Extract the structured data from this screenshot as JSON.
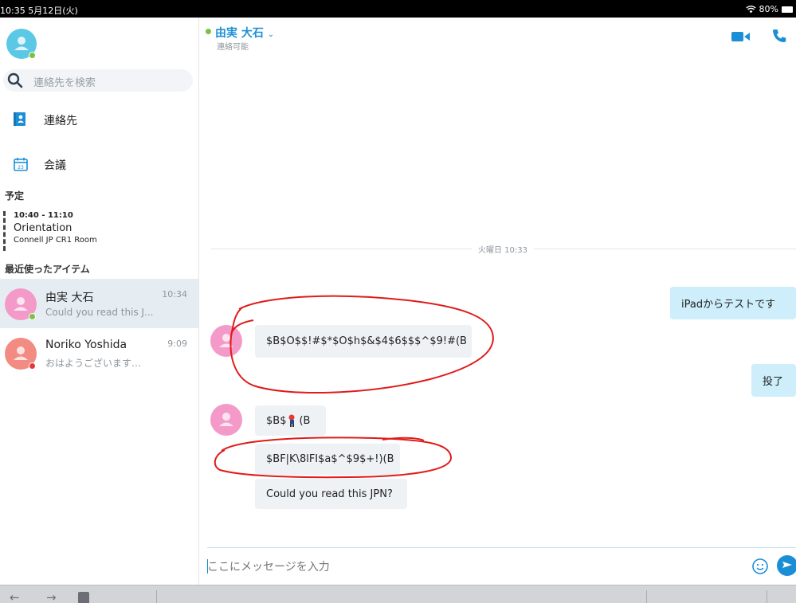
{
  "status_bar": {
    "time": "10:35  5月12日(火)",
    "battery": "80%"
  },
  "sidebar": {
    "search_placeholder": "連絡先を検索",
    "nav": [
      {
        "label": "連絡先",
        "icon": "contacts-book-icon"
      },
      {
        "label": "会議",
        "icon": "calendar-icon"
      }
    ],
    "schedule_heading": "予定",
    "schedule": {
      "time": "10:40 - 11:10",
      "title": "Orientation",
      "room": "Connell JP CR1 Room"
    },
    "recent_heading": "最近使ったアイテム",
    "conversations": [
      {
        "name": "由実  大石",
        "preview": "Could you read this J...",
        "time": "10:34",
        "presence": "online",
        "active": true,
        "avatar_color": "#f49ac8"
      },
      {
        "name": "Noriko Yoshida",
        "preview": "おはようございます…",
        "time": "9:09",
        "presence": "busy",
        "active": false,
        "avatar_color": "#f28b82"
      }
    ]
  },
  "chat": {
    "contact_name": "由実  大石",
    "contact_status": "連絡可能",
    "date_divider": "火曜日 10:33",
    "messages": [
      {
        "direction": "out",
        "text": "iPadからテストです"
      },
      {
        "direction": "in",
        "text": "$B$O$$!#$*$O$h$&$4$6$$$^$9!#(B"
      },
      {
        "direction": "out",
        "text": "投了"
      },
      {
        "direction": "in",
        "text": "$B$",
        "suffix": "(B"
      },
      {
        "direction": "in",
        "text": "$BF|K\\8lFI$a$^$9$+!)(B"
      },
      {
        "direction": "in",
        "text": "Could you read this JPN?"
      }
    ],
    "composer_placeholder": "ここにメッセージを入力"
  },
  "colors": {
    "accent": "#1a8fd6",
    "online": "#7cc142",
    "busy": "#e23a3a",
    "annotation": "#e01b1b"
  }
}
